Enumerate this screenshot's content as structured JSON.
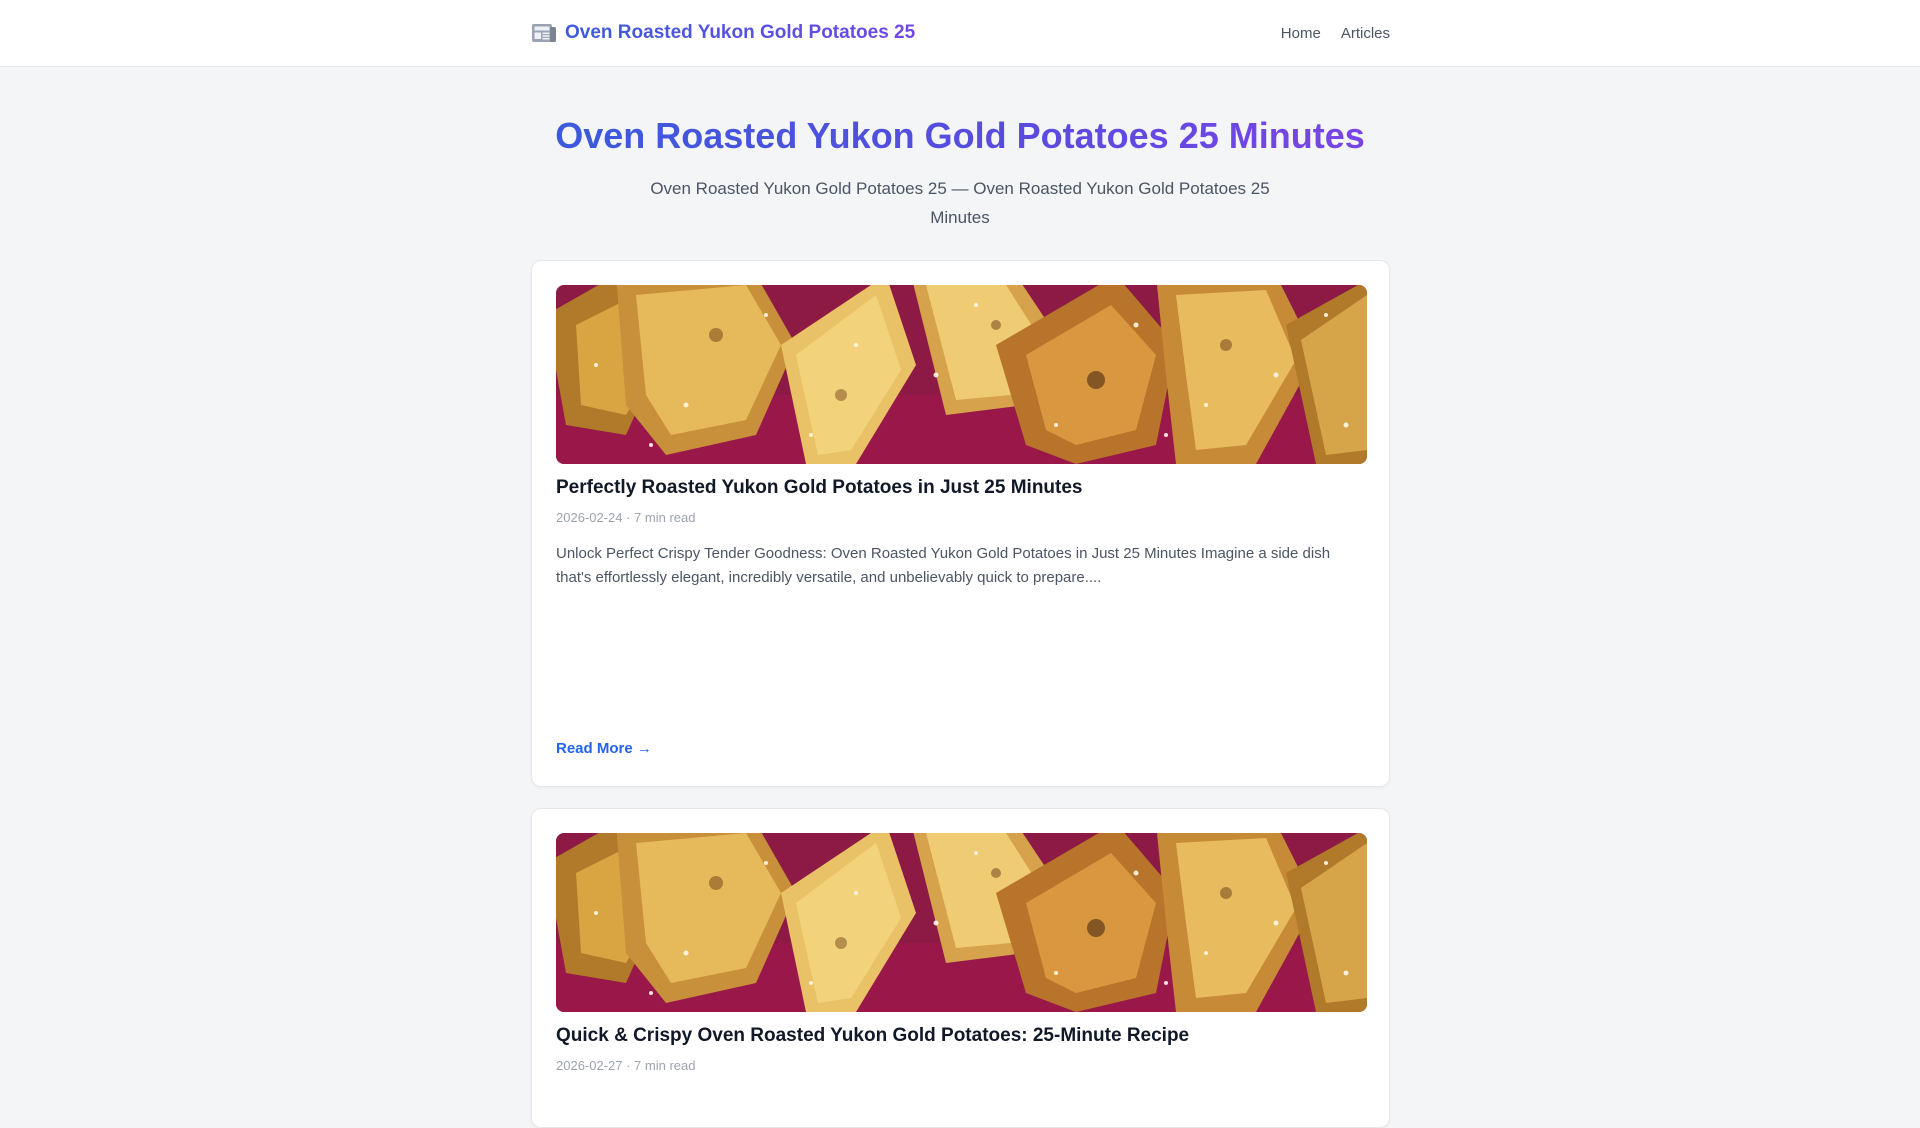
{
  "header": {
    "brand_icon": "newspaper-icon",
    "brand_title": "Oven Roasted Yukon Gold Potatoes 25",
    "nav": [
      {
        "label": "Home"
      },
      {
        "label": "Articles"
      }
    ]
  },
  "hero": {
    "title": "Oven Roasted Yukon Gold Potatoes 25 Minutes",
    "subtitle": "Oven Roasted Yukon Gold Potatoes 25 — Oven Roasted Yukon Gold Potatoes 25 Minutes"
  },
  "articles": [
    {
      "title": "Perfectly Roasted Yukon Gold Potatoes in Just 25 Minutes",
      "meta": "2026-02-24 · 7 min read",
      "excerpt": "Unlock Perfect Crispy Tender Goodness: Oven Roasted Yukon Gold Potatoes in Just 25 Minutes Imagine a side dish that's effortlessly elegant, incredibly versatile, and unbelievably quick to prepare....",
      "read_more": "Read More →"
    },
    {
      "title": "Quick & Crispy Oven Roasted Yukon Gold Potatoes: 25-Minute Recipe",
      "meta": "2026-02-27 · 7 min read"
    }
  ],
  "colors": {
    "accent_start": "#3b5bdb",
    "accent_end": "#7048e8",
    "link": "#2563eb",
    "background": "#f4f5f7"
  }
}
